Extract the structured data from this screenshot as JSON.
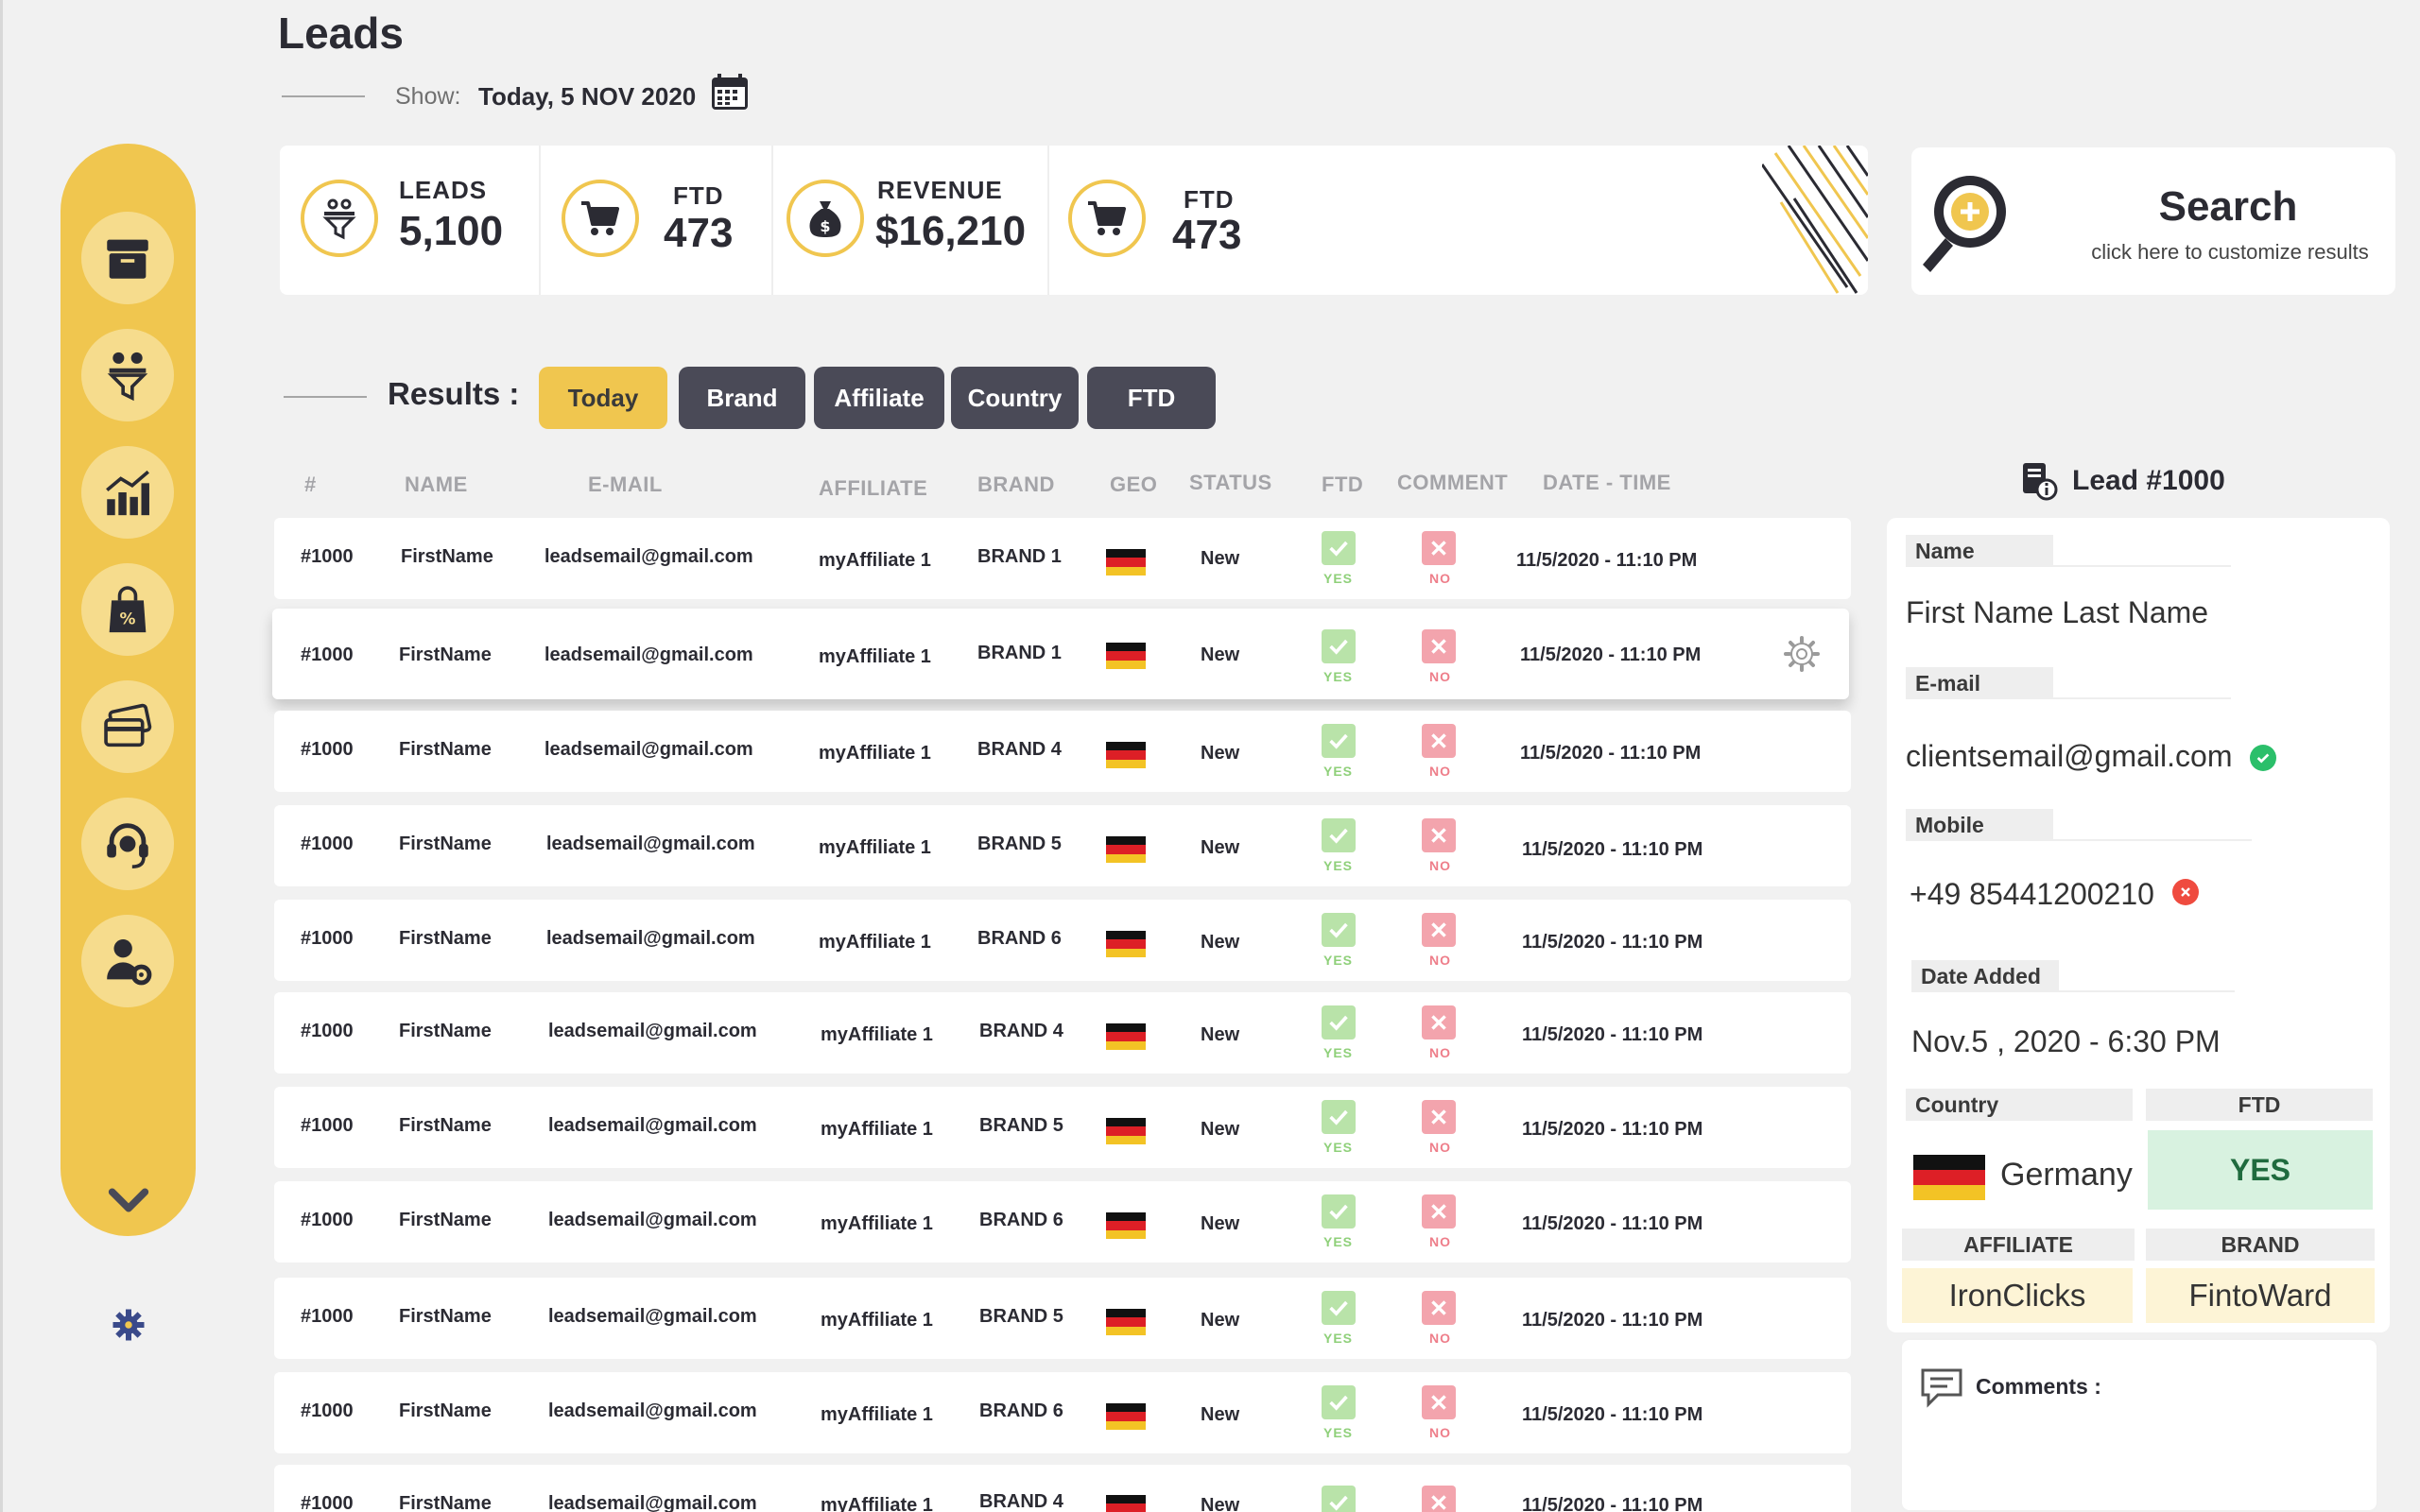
{
  "page": {
    "title": "Leads",
    "show_label": "Show:",
    "show_value": "Today, 5 NOV 2020"
  },
  "sidebar": {
    "items": [
      {
        "name": "archive",
        "icon": "archive-box-icon"
      },
      {
        "name": "leads",
        "icon": "leads-funnel-icon"
      },
      {
        "name": "analytics",
        "icon": "bar-chart-icon"
      },
      {
        "name": "offers",
        "icon": "discount-bag-icon"
      },
      {
        "name": "payments",
        "icon": "credit-cards-icon"
      },
      {
        "name": "support",
        "icon": "headset-icon"
      },
      {
        "name": "user-settings",
        "icon": "user-gear-icon"
      }
    ],
    "expand_icon": "chevron-down-icon",
    "settings_icon": "gear-icon"
  },
  "stats": [
    {
      "label": "LEADS",
      "value": "5,100",
      "icon": "leads-funnel-icon"
    },
    {
      "label": "FTD",
      "value": "473",
      "icon": "cart-icon"
    },
    {
      "label": "REVENUE",
      "value": "$16,210",
      "icon": "money-bag-icon"
    },
    {
      "label": "FTD",
      "value": "473",
      "icon": "cart-icon"
    }
  ],
  "search": {
    "title": "Search",
    "subtitle": "click here to customize results"
  },
  "results": {
    "label": "Results :",
    "filters": [
      "Today",
      "Brand",
      "Affiliate",
      "Country",
      "FTD"
    ],
    "active_filter": "Today"
  },
  "table": {
    "headers": [
      "#",
      "NAME",
      "E-MAIL",
      "AFFILIATE",
      "BRAND",
      "GEO",
      "STATUS",
      "FTD",
      "COMMENT",
      "DATE - TIME"
    ],
    "yes_label": "YES",
    "no_label": "NO",
    "rows": [
      {
        "id": "#1000",
        "name": "FirstName",
        "email": "leadsemail@gmail.com",
        "affiliate": "myAffiliate 1",
        "brand": "BRAND 1",
        "status": "New",
        "datetime": "11/5/2020 - 11:10 PM"
      },
      {
        "id": "#1000",
        "name": "FirstName",
        "email": "leadsemail@gmail.com",
        "affiliate": "myAffiliate 1",
        "brand": "BRAND 1",
        "status": "New",
        "datetime": "11/5/2020 - 11:10 PM"
      },
      {
        "id": "#1000",
        "name": "FirstName",
        "email": "leadsemail@gmail.com",
        "affiliate": "myAffiliate 1",
        "brand": "BRAND 4",
        "status": "New",
        "datetime": "11/5/2020 - 11:10 PM"
      },
      {
        "id": "#1000",
        "name": "FirstName",
        "email": "leadsemail@gmail.com",
        "affiliate": "myAffiliate 1",
        "brand": "BRAND 5",
        "status": "New",
        "datetime": "11/5/2020 - 11:10 PM"
      },
      {
        "id": "#1000",
        "name": "FirstName",
        "email": "leadsemail@gmail.com",
        "affiliate": "myAffiliate 1",
        "brand": "BRAND 6",
        "status": "New",
        "datetime": "11/5/2020 - 11:10 PM"
      },
      {
        "id": "#1000",
        "name": "FirstName",
        "email": "leadsemail@gmail.com",
        "affiliate": "myAffiliate 1",
        "brand": "BRAND 4",
        "status": "New",
        "datetime": "11/5/2020 - 11:10 PM"
      },
      {
        "id": "#1000",
        "name": "FirstName",
        "email": "leadsemail@gmail.com",
        "affiliate": "myAffiliate 1",
        "brand": "BRAND 5",
        "status": "New",
        "datetime": "11/5/2020 - 11:10 PM"
      },
      {
        "id": "#1000",
        "name": "FirstName",
        "email": "leadsemail@gmail.com",
        "affiliate": "myAffiliate 1",
        "brand": "BRAND 6",
        "status": "New",
        "datetime": "11/5/2020 - 11:10 PM"
      },
      {
        "id": "#1000",
        "name": "FirstName",
        "email": "leadsemail@gmail.com",
        "affiliate": "myAffiliate 1",
        "brand": "BRAND 5",
        "status": "New",
        "datetime": "11/5/2020 - 11:10 PM"
      },
      {
        "id": "#1000",
        "name": "FirstName",
        "email": "leadsemail@gmail.com",
        "affiliate": "myAffiliate 1",
        "brand": "BRAND 6",
        "status": "New",
        "datetime": "11/5/2020 - 11:10 PM"
      },
      {
        "id": "#1000",
        "name": "FirstName",
        "email": "leadsemail@gmail.com",
        "affiliate": "myAffiliate 1",
        "brand": "BRAND 4",
        "status": "New",
        "datetime": "11/5/2020 - 11:10 PM"
      }
    ]
  },
  "lead_detail": {
    "title": "Lead #1000",
    "name_label": "Name",
    "name_value": "First Name  Last Name",
    "email_label": "E-mail",
    "email_value": "clientsemail@gmail.com",
    "mobile_label": "Mobile",
    "mobile_value": "+49 85441200210",
    "date_label": "Date Added",
    "date_value": "Nov.5 , 2020 - 6:30 PM",
    "country_label": "Country",
    "country_value": "Germany",
    "ftd_label": "FTD",
    "ftd_value": "YES",
    "affiliate_label": "AFFILIATE",
    "affiliate_value": "IronClicks",
    "brand_label": "BRAND",
    "brand_value": "FintoWard",
    "comments_label": "Comments :"
  },
  "colors": {
    "accent": "#f0c64f",
    "dark_chip": "#4a4a57",
    "yes_green": "#8fd07a",
    "no_red": "#ee7e8a"
  }
}
